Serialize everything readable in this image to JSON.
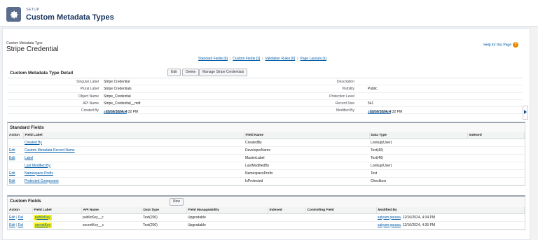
{
  "header": {
    "setup_label": "SETUP",
    "title": "Custom Metadata Types"
  },
  "record": {
    "type_label": "Custom Metadata Type",
    "name": "Stripe Credential"
  },
  "help_link": "Help for this Page",
  "quick_links": [
    "Standard Fields [6]",
    "Custom Fields [2]",
    "Validation Rules [0]",
    "Page Layouts [1]"
  ],
  "detail": {
    "title": "Custom Metadata Type Detail",
    "buttons": [
      "Edit",
      "Delete",
      "Manage Stripe Credentials"
    ],
    "left": [
      {
        "label": "Singular Label",
        "value": "Stripe Credential"
      },
      {
        "label": "Plural Label",
        "value": "Stripe Credentials"
      },
      {
        "label": "Object Name",
        "value": "Stripe_Credential"
      },
      {
        "label": "API Name",
        "value": "Stripe_Credential__mdt"
      },
      {
        "label": "Created By",
        "user": "satyam parasa",
        "value": ", 12/16/2024, 4:32 PM"
      }
    ],
    "right": [
      {
        "label": "Description",
        "value": ""
      },
      {
        "label": "Visibility",
        "value": "Public"
      },
      {
        "label": "Protection Level",
        "value": ""
      },
      {
        "label": "Record Size",
        "value": "541"
      },
      {
        "label": "Modified By",
        "user": "satyam parasa",
        "value": ", 12/16/2024, 4:32 PM"
      }
    ]
  },
  "standard_fields": {
    "title": "Standard Fields",
    "columns": [
      "Action",
      "Field Label",
      "Field Name",
      "Data Type",
      "Indexed"
    ],
    "rows": [
      {
        "action": "",
        "label": "Created By",
        "name": "CreatedBy",
        "type": "Lookup(User)"
      },
      {
        "action": "Edit",
        "label": "Custom Metadata Record Name",
        "name": "DeveloperName",
        "type": "Text(40)"
      },
      {
        "action": "Edit",
        "label": "Label",
        "name": "MasterLabel",
        "type": "Text(40)"
      },
      {
        "action": "",
        "label": "Last Modified By",
        "name": "LastModifiedBy",
        "type": "Lookup(User)"
      },
      {
        "action": "Edit",
        "label": "Namespace Prefix",
        "name": "NamespacePrefix",
        "type": "Text"
      },
      {
        "action": "Edit",
        "label": "Protected Component",
        "name": "IsProtected",
        "type": "Checkbox"
      }
    ]
  },
  "custom_fields": {
    "title": "Custom Fields",
    "new_button": "New",
    "columns": [
      "Action",
      "Field Label",
      "API Name",
      "Data Type",
      "Field Manageability",
      "Indexed",
      "Controlling Field",
      "Modified By"
    ],
    "rows": [
      {
        "edit": "Edit",
        "del": "Del",
        "label": "publicKey",
        "api": "publicKey__c",
        "type": "Text(200)",
        "manage": "Upgradable",
        "user": "satyam parasa",
        "modified": ", 12/16/2024, 4:34 PM"
      },
      {
        "edit": "Edit",
        "del": "Del",
        "label": "secretKey",
        "api": "secretKey__c",
        "type": "Text(200)",
        "manage": "Upgradable",
        "user": "satyam parasa",
        "modified": ", 12/16/2024, 4:35 PM"
      }
    ]
  },
  "colors": {
    "highlight": "#f7f21a",
    "link": "#015ba7",
    "brand": "#5a6d8c"
  }
}
